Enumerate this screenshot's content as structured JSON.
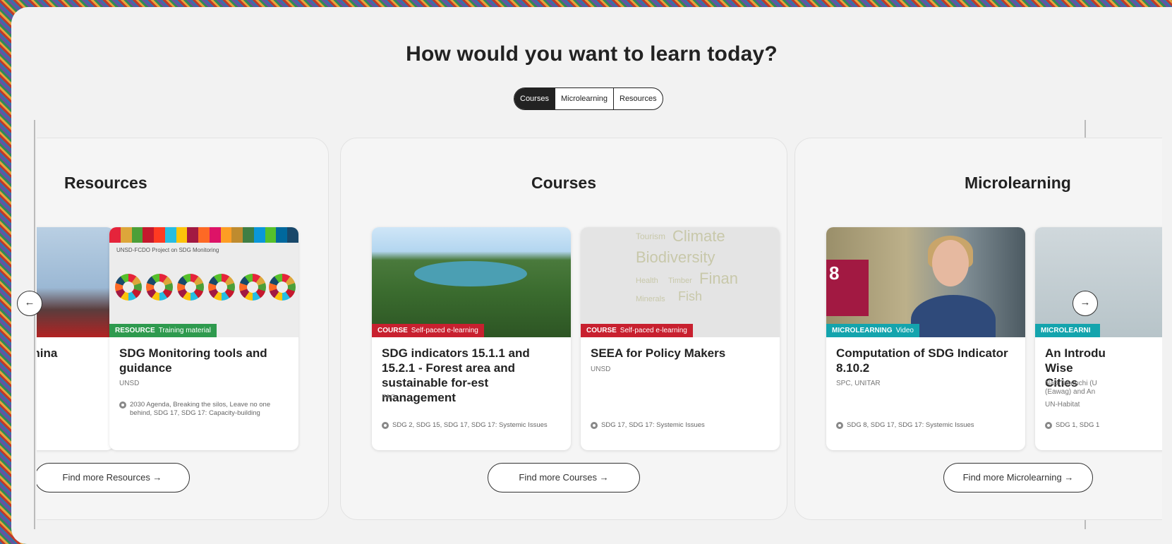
{
  "heading": "How would you want to learn today?",
  "tabs": [
    {
      "label": "Courses",
      "active": true
    },
    {
      "label": "Microlearning",
      "active": false
    },
    {
      "label": "Resources",
      "active": false
    }
  ],
  "groups": {
    "resources": {
      "title": "Resources",
      "button": "Find more Resources →",
      "cards": [
        {
          "title": "n China",
          "org": "",
          "badge_type": "",
          "badge_sub": "",
          "tags": ""
        },
        {
          "title": "SDG Monitoring tools and guidance",
          "org": "UNSD",
          "badge_type": "RESOURCE",
          "badge_sub": "Training material",
          "tags": "2030 Agenda, Breaking the silos, Leave no one behind, SDG 17, SDG 17: Capacity-building"
        }
      ]
    },
    "courses": {
      "title": "Courses",
      "button": "Find more Courses →",
      "cards": [
        {
          "title": "SDG indicators 15.1.1 and 15.2.1 - Forest area and sustainable for-est management",
          "org": "FAO",
          "badge_type": "COURSE",
          "badge_sub": "Self-paced e-learning",
          "tags": "SDG 2, SDG 15, SDG 17, SDG 17: Systemic Issues"
        },
        {
          "title": "SEEA for Policy Makers",
          "org": "UNSD",
          "badge_type": "COURSE",
          "badge_sub": "Self-paced e-learning",
          "tags": "SDG 17, SDG 17: Systemic Issues"
        }
      ]
    },
    "microlearning": {
      "title": "Microlearning",
      "button": "Find more Microlearning →",
      "cards": [
        {
          "title": "Computation of SDG Indicator 8.10.2",
          "org": "SPC, UNITAR",
          "badge_type": "MICROLEARNING",
          "badge_sub": "Video",
          "tags": "SDG 8, SDG 17, SDG 17: Systemic Issues"
        },
        {
          "title": "An Introdu Wise Cities",
          "org": "Nao Takeuchi (U (Eawag) and An",
          "org2": "UN-Habitat",
          "badge_type": "MICROLEARNI",
          "badge_sub": "",
          "tags": "SDG 1, SDG 1"
        }
      ]
    }
  },
  "images": {
    "sdg_header": "UNSD-FCDO Project on SDG Monitoring",
    "sdg8_label": "8",
    "word_cloud": [
      "Tourism",
      "Climate",
      "Biodiversity",
      "Health",
      "Timber",
      "Finan",
      "Minerals",
      "Fish"
    ]
  },
  "nav": {
    "prev": "←",
    "next": "→"
  }
}
